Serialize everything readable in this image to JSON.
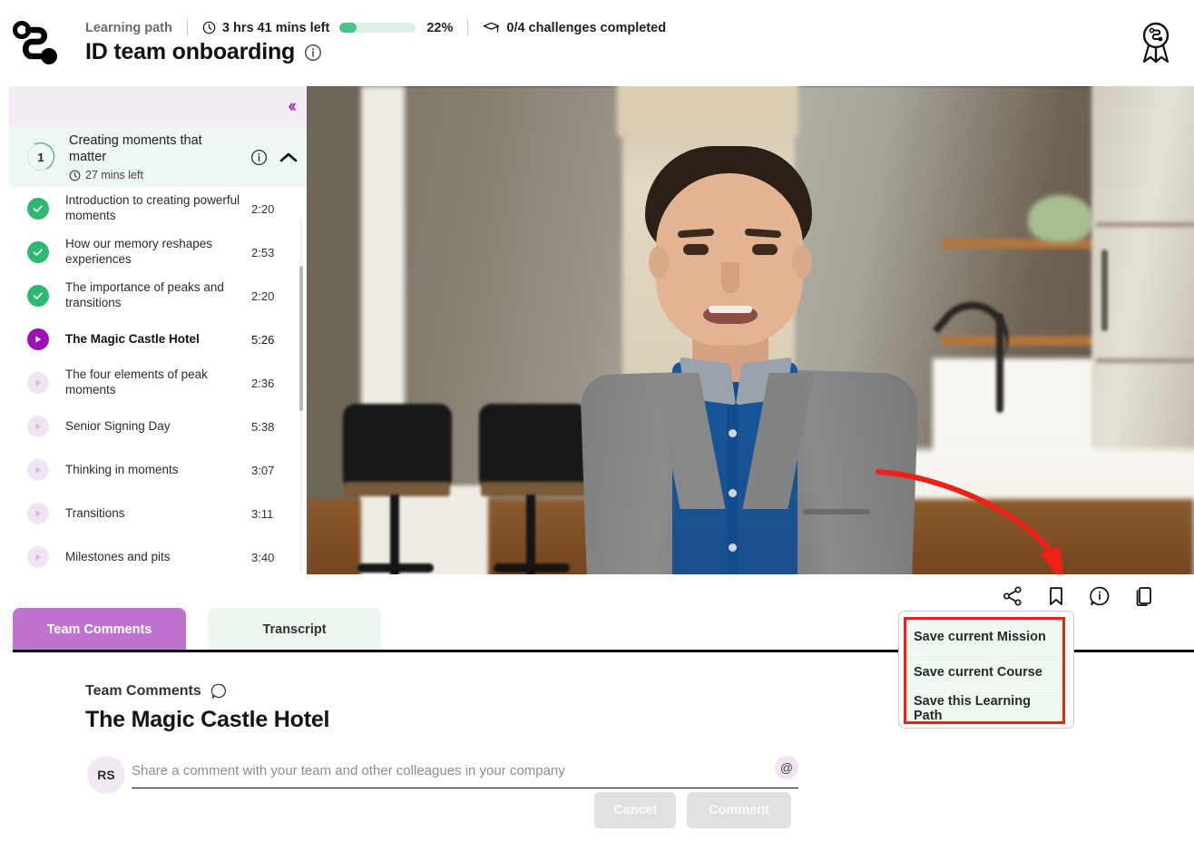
{
  "header": {
    "logo_icon": "learning-path-logo",
    "breadcrumb_label": "Learning path",
    "time_left": "3 hrs 41 mins left",
    "clock_icon": "clock-icon",
    "progress_percent": "22%",
    "progress_value": 22,
    "challenges_icon": "graduation-cap-icon",
    "challenges_text": "0/4 challenges completed",
    "title": "ID team onboarding",
    "info_icon": "info-icon",
    "award_icon": "award-ribbon-icon"
  },
  "sidebar": {
    "collapse_icon": "chevron-double-left-icon",
    "chapter": {
      "number": "1",
      "title": "Creating moments that matter",
      "time_left": "27 mins left",
      "clock_icon": "clock-icon",
      "info_icon": "info-icon",
      "collapse_icon": "chevron-up-icon"
    },
    "lessons": [
      {
        "title": "Introduction to creating powerful moments",
        "duration": "2:20",
        "state": "completed",
        "icon": "check-circle-icon"
      },
      {
        "title": "How our memory reshapes experiences",
        "duration": "2:53",
        "state": "completed",
        "icon": "check-circle-icon"
      },
      {
        "title": "The importance of peaks and transitions",
        "duration": "2:20",
        "state": "completed",
        "icon": "check-circle-icon"
      },
      {
        "title": "The Magic Castle Hotel",
        "duration": "5:26",
        "state": "active",
        "icon": "play-circle-icon"
      },
      {
        "title": "The four elements of peak moments",
        "duration": "2:36",
        "state": "locked",
        "icon": "play-circle-icon"
      },
      {
        "title": "Senior Signing Day",
        "duration": "5:38",
        "state": "locked",
        "icon": "play-circle-icon"
      },
      {
        "title": "Thinking in moments",
        "duration": "3:07",
        "state": "locked",
        "icon": "play-circle-icon"
      },
      {
        "title": "Transitions",
        "duration": "3:11",
        "state": "locked",
        "icon": "play-circle-icon"
      },
      {
        "title": "Milestones and pits",
        "duration": "3:40",
        "state": "locked",
        "icon": "play-circle-icon"
      }
    ]
  },
  "video": {
    "description": "Man in grey blazer and blue shirt speaking in a blurred modern kitchen"
  },
  "action_bar": {
    "icons": [
      {
        "name": "share-icon"
      },
      {
        "name": "bookmark-icon"
      },
      {
        "name": "info-bubble-icon"
      },
      {
        "name": "copy-icon"
      }
    ]
  },
  "save_dropdown": {
    "items": [
      {
        "label": "Save current Mission"
      },
      {
        "label": "Save current Course"
      },
      {
        "label": "Save this Learning Path"
      }
    ],
    "highlight_color": "#ee2116",
    "background_color": "#eef7f0"
  },
  "tabs": [
    {
      "label": "Team Comments",
      "active": true
    },
    {
      "label": "Transcript",
      "active": false
    }
  ],
  "comments": {
    "kicker": "Team Comments",
    "kicker_icon": "comment-bubble-icon",
    "title": "The Magic Castle Hotel",
    "avatar_initials": "RS",
    "input_placeholder": "Share a comment with your team and other colleagues in your company",
    "input_value": "",
    "mention_icon": "at-icon",
    "cancel_label": "Cancel",
    "comment_label": "Comment"
  },
  "colors": {
    "accent_purple": "#9b11b5",
    "tab_active": "#bf72cf",
    "progress_green": "#4cc38a",
    "completed_green": "#2eb872",
    "highlight_red": "#ee2116"
  }
}
